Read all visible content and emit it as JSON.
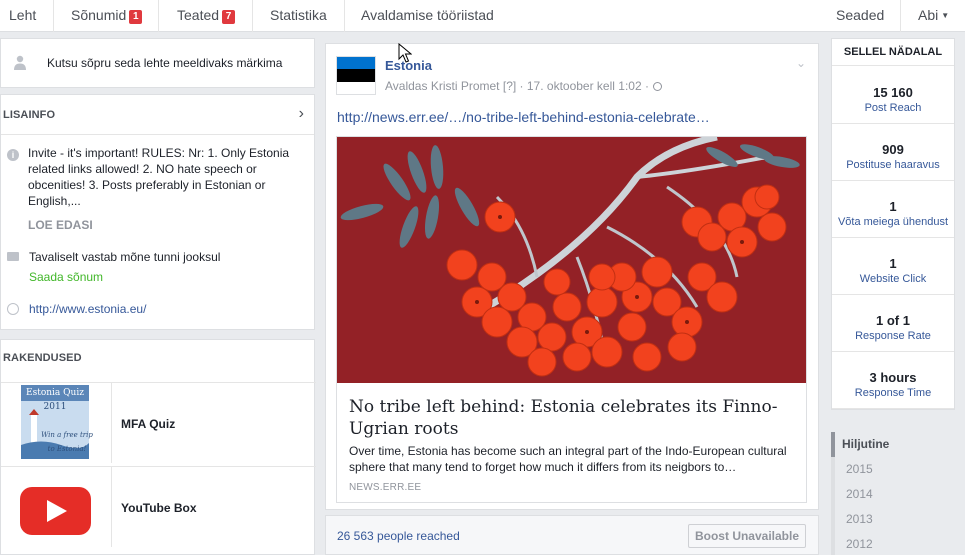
{
  "nav": {
    "items": [
      {
        "label": "Leht",
        "badge": ""
      },
      {
        "label": "Sõnumid",
        "badge": "1"
      },
      {
        "label": "Teated",
        "badge": "7"
      },
      {
        "label": "Statistika",
        "badge": ""
      },
      {
        "label": "Avaldamise tööriistad",
        "badge": ""
      }
    ],
    "settings": "Seaded",
    "help": "Abi"
  },
  "invite": {
    "text": "Kutsu sõpru seda lehte meeldivaks märkima"
  },
  "about": {
    "title": "LISAINFO",
    "description": "Invite - it's important! RULES: Nr: 1. Only Estonia related links allowed! 2. NO hate speech or obcenities! 3. Posts preferably in Estonian or English,...",
    "read_more": "LOE EDASI",
    "response": "Tavaliselt vastab mõne tunni jooksul",
    "send_message": "Saada sõnum",
    "website": "http://www.estonia.eu/"
  },
  "apps": {
    "title": "RAKENDUSED",
    "items": [
      {
        "name": "MFA Quiz",
        "thumb_title": "Estonia Quiz",
        "thumb_year": "2011",
        "thumb_text": "Win a free trip to Estonia!",
        "icon": "quiz-thumbnail"
      },
      {
        "name": "YouTube Box",
        "icon": "youtube-play-icon"
      }
    ]
  },
  "post": {
    "page_name": "Estonia",
    "author_prefix": "Avaldas",
    "author": "Kristi Promet",
    "author_badge": "[?]",
    "date": "17. oktoober kell 1:02",
    "link": "http://news.err.ee/…/no-tribe-left-behind-estonia-celebrate…",
    "card": {
      "title": "No tribe left behind: Estonia celebrates its Finno-Ugrian roots",
      "description": "Over time, Estonia has become such an integral part of the Indo-European cultural sphere that many tend to forget how much it differs from its neigbors to…",
      "source": "NEWS.ERR.EE"
    },
    "reach": "26 563 people reached",
    "boost": "Boost Unavailable",
    "flag_colors": [
      "#0072ce",
      "#000000",
      "#ffffff"
    ]
  },
  "stats": {
    "title": "SELLEL NÄDALAL",
    "items": [
      {
        "value": "15 160",
        "label": "Post Reach"
      },
      {
        "value": "909",
        "label": "Postituse haaravus"
      },
      {
        "value": "1",
        "label": "Võta meiega ühendust"
      },
      {
        "value": "1",
        "label": "Website Click"
      },
      {
        "value": "1 of 1",
        "label": "Response Rate"
      },
      {
        "value": "3 hours",
        "label": "Response Time"
      }
    ]
  },
  "timeline": [
    "Hiljutine",
    "2015",
    "2014",
    "2013",
    "2012"
  ],
  "colors": {
    "link": "#365899",
    "green": "#42b72a",
    "badge": "#e0393e",
    "background": "#e9ebee"
  }
}
